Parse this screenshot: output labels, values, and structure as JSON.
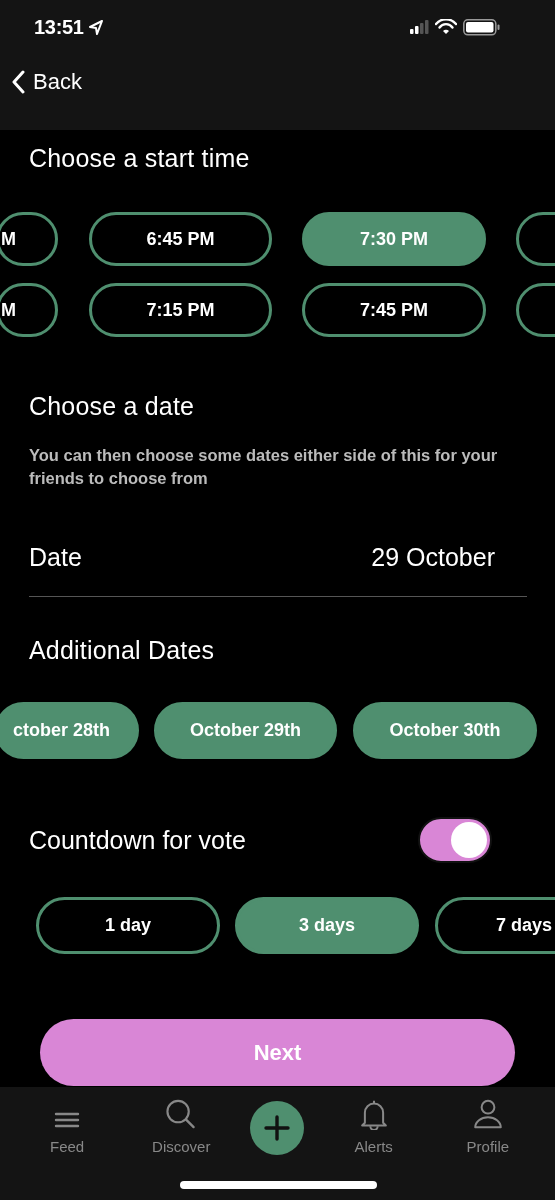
{
  "status_bar": {
    "time": "13:51"
  },
  "nav": {
    "back": "Back"
  },
  "start_time": {
    "title": "Choose a start time",
    "rows": [
      [
        {
          "label": "M",
          "selected": false
        },
        {
          "label": "6:45 PM",
          "selected": false
        },
        {
          "label": "7:30 PM",
          "selected": true
        },
        {
          "selected": false
        }
      ],
      [
        {
          "label": "M",
          "selected": false
        },
        {
          "label": "7:15 PM",
          "selected": false
        },
        {
          "label": "7:45 PM",
          "selected": false
        },
        {
          "selected": false
        }
      ]
    ]
  },
  "date": {
    "title": "Choose a date",
    "description": "You can then choose some dates either side of this for your friends to choose from",
    "field": {
      "label": "Date",
      "value": "29 October"
    }
  },
  "additional_dates": {
    "title": "Additional Dates",
    "chips": [
      {
        "label": "ctober 28th",
        "selected": true
      },
      {
        "label": "October 29th",
        "selected": true
      },
      {
        "label": "October 30th",
        "selected": true
      }
    ]
  },
  "countdown": {
    "label": "Countdown for vote",
    "on": true,
    "options": [
      {
        "label": "1 day",
        "selected": false
      },
      {
        "label": "3 days",
        "selected": true
      },
      {
        "label": "7 days",
        "selected": false
      }
    ]
  },
  "next_button": {
    "label": "Next"
  },
  "tab_bar": {
    "items": [
      {
        "kind": "feed",
        "label": "Feed"
      },
      {
        "kind": "discover",
        "label": "Discover"
      },
      {
        "kind": "create"
      },
      {
        "kind": "alerts",
        "label": "Alerts"
      },
      {
        "kind": "profile",
        "label": "Profile"
      }
    ]
  }
}
